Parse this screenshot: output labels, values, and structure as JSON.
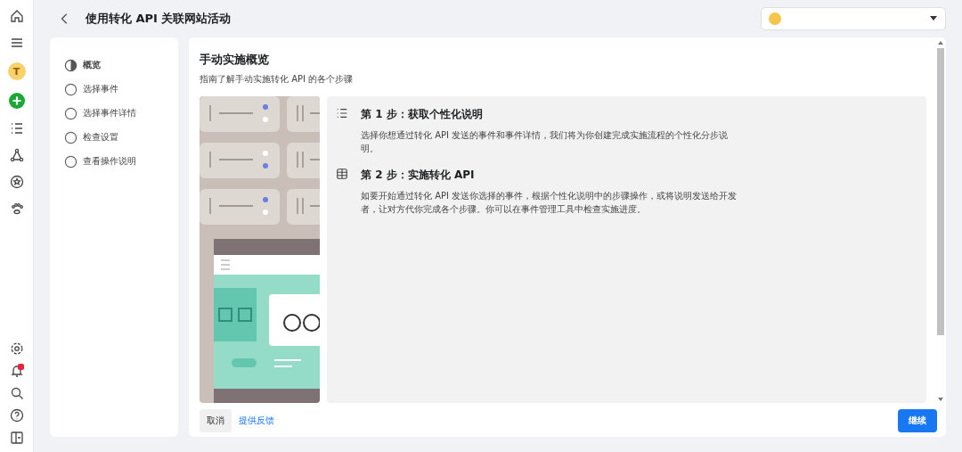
{
  "rail": {
    "avatar": "T"
  },
  "header": {
    "title": "使用转化 API 关联网站活动"
  },
  "steps": [
    {
      "label": "概览",
      "selected": true
    },
    {
      "label": "选择事件",
      "selected": false
    },
    {
      "label": "选择事件详情",
      "selected": false
    },
    {
      "label": "检查设置",
      "selected": false
    },
    {
      "label": "查看操作说明",
      "selected": false
    }
  ],
  "main": {
    "title": "手动实施概览",
    "subtitle": "指南了解手动实施转化 API 的各个步骤",
    "items": [
      {
        "kind": "list",
        "title": "第 1 步：获取个性化说明",
        "text": "选择你想通过转化 API 发送的事件和事件详情，我们将为你创建完成实施流程的个性化分步说明。"
      },
      {
        "kind": "stack",
        "title": "第 2 步：实施转化 API",
        "text": "如要开始通过转化 API 发送你选择的事件，根据个性化说明中的步骤操作，或将说明发送给开发者，让对方代你完成各个步骤。你可以在事件管理工具中检查实施进度。"
      }
    ]
  },
  "footer": {
    "cancel": "取消",
    "feedback": "提供反馈",
    "continue": "继续"
  }
}
